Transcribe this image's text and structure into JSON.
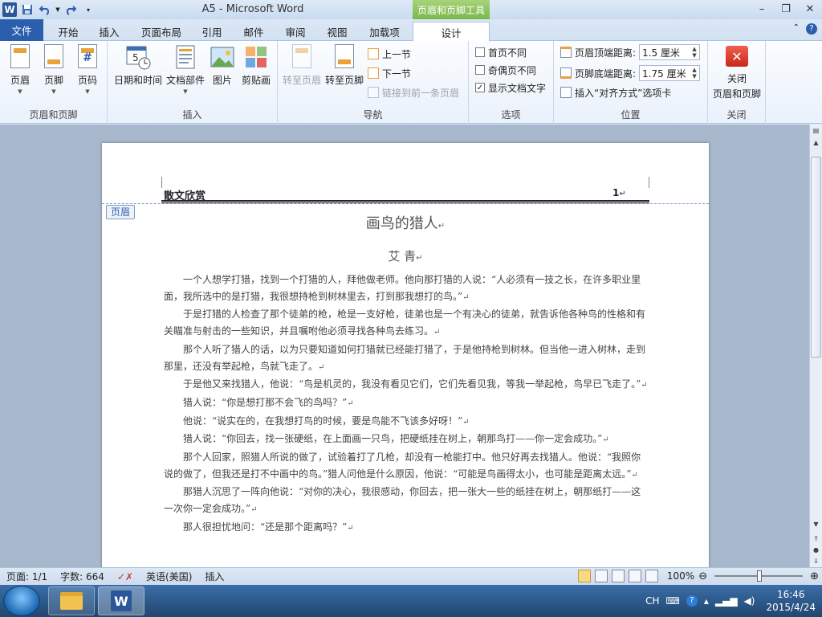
{
  "window": {
    "title": "A5 - Microsoft Word",
    "context_tool_title": "页眉和页脚工具"
  },
  "tabs": [
    "文件",
    "开始",
    "插入",
    "页面布局",
    "引用",
    "邮件",
    "审阅",
    "视图",
    "加载项",
    "设计"
  ],
  "ribbon": {
    "group_header_footer": {
      "label": "页眉和页脚",
      "header_btn": "页眉",
      "footer_btn": "页脚",
      "page_number_btn": "页码"
    },
    "group_insert": {
      "label": "插入",
      "datetime_btn": "日期和时间",
      "docparts_btn": "文档部件",
      "picture_btn": "图片",
      "clipart_btn": "剪贴画"
    },
    "group_nav": {
      "label": "导航",
      "goto_header_btn": "转至页眉",
      "goto_footer_btn": "转至页脚",
      "prev_btn": "上一节",
      "next_btn": "下一节",
      "link_prev_btn": "链接到前一条页眉"
    },
    "group_options": {
      "label": "选项",
      "diff_first_page": "首页不同",
      "diff_odd_even": "奇偶页不同",
      "show_doc_text": "显示文档文字",
      "show_doc_text_checked": true
    },
    "group_position": {
      "label": "位置",
      "header_from_top_label": "页眉顶端距离:",
      "header_from_top_value": "1.5 厘米",
      "footer_from_bottom_label": "页脚底端距离:",
      "footer_from_bottom_value": "1.75 厘米",
      "insert_align_tab": "插入“对齐方式”选项卡"
    },
    "group_close": {
      "label": "关闭",
      "close_btn_line1": "关闭",
      "close_btn_line2": "页眉和页脚"
    }
  },
  "document": {
    "header_text": "散文欣赏",
    "header_page_number": "1",
    "header_tag": "页眉",
    "title": "画鸟的猎人",
    "author": "艾 青",
    "paragraphs": [
      "一个人想学打猎，找到一个打猎的人，拜他做老师。他向那打猎的人说：“人必须有一技之长，在许多职业里面，我所选中的是打猎，我很想持枪到树林里去，打到那我想打的鸟。”",
      "于是打猎的人检查了那个徒弟的枪，枪是一支好枪，徒弟也是一个有决心的徒弟，就告诉他各种鸟的性格和有关瞄准与射击的一些知识，并且嘱咐他必须寻找各种鸟去练习。",
      "那个人听了猎人的话，以为只要知道如何打猎就已经能打猎了，于是他持枪到树林。但当他一进入树林，走到那里，还没有举起枪，鸟就飞走了。",
      "于是他又来找猎人，他说：“鸟是机灵的，我没有看见它们，它们先看见我，等我一举起枪，鸟早已飞走了。”",
      "猎人说：“你是想打那不会飞的鸟吗？”",
      "他说：“说实在的，在我想打鸟的时候，要是鸟能不飞该多好呀！”",
      "猎人说：“你回去，找一张硬纸，在上面画一只鸟，把硬纸挂在树上，朝那鸟打——你一定会成功。”",
      "那个人回家，照猎人所说的做了，试验着打了几枪，却没有一枪能打中。他只好再去找猎人。他说：“我照你说的做了，但我还是打不中画中的鸟。”猎人问他是什么原因，他说：“可能是鸟画得太小，也可能是距离太远。”",
      "那猎人沉思了一阵向他说：“对你的决心，我很感动，你回去，把一张大一些的纸挂在树上，朝那纸打——这一次你一定会成功。”",
      "那人很担忧地问：“还是那个距离吗？”"
    ]
  },
  "statusbar": {
    "page": "页面: 1/1",
    "words": "字数: 664",
    "language": "英语(美国)",
    "insert_mode": "插入",
    "zoom": "100%"
  },
  "taskbar": {
    "ime": "CH",
    "time": "16:46",
    "date": "2015/4/24"
  }
}
